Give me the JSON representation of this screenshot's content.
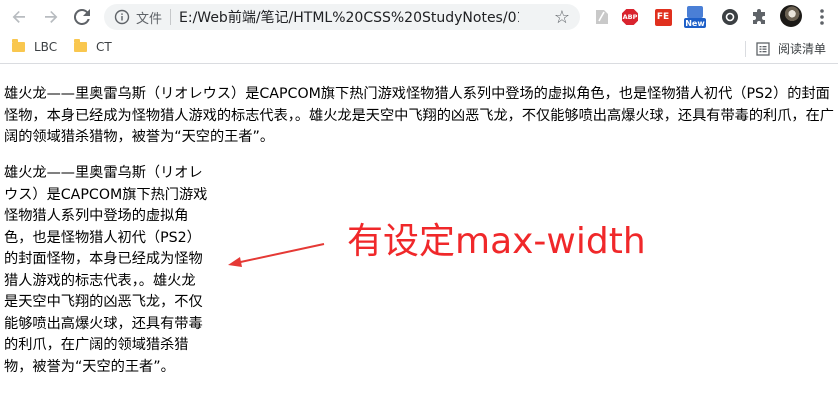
{
  "browser": {
    "nav": {
      "back_icon": "arrow-left-icon",
      "forward_icon": "arrow-right-icon",
      "reload_icon": "reload-icon"
    },
    "omnibox": {
      "protocol_label": "文件",
      "url": "E:/Web前端/笔记/HTML%20CSS%20StudyNotes/01...",
      "bookmark_icon": "star-icon"
    },
    "extensions": {
      "abp_label": "ABP",
      "fe_label": "FE",
      "new_badge": "New"
    },
    "bookmarks_bar": {
      "items": [
        {
          "label": "LBC"
        },
        {
          "label": "CT"
        }
      ],
      "reading_list_label": "阅读清单"
    }
  },
  "page": {
    "paragraph_text": "雄火龙——里奥雷乌斯（リオレウス）是CAPCOM旗下热门游戏怪物猎人系列中登场的虚拟角色，也是怪物猎人初代（PS2）的封面怪物，本身已经成为怪物猎人游戏的标志代表，。雄火龙是天空中飞翔的凶恶飞龙，不仅能够喷出高爆火球，还具有带毒的利爪，在广阔的领域猎杀猎物，被誉为“天空的王者”。",
    "annotation": "有设定max-width"
  },
  "colors": {
    "annotation": "#f0282a",
    "folder": "#f9c74f"
  }
}
